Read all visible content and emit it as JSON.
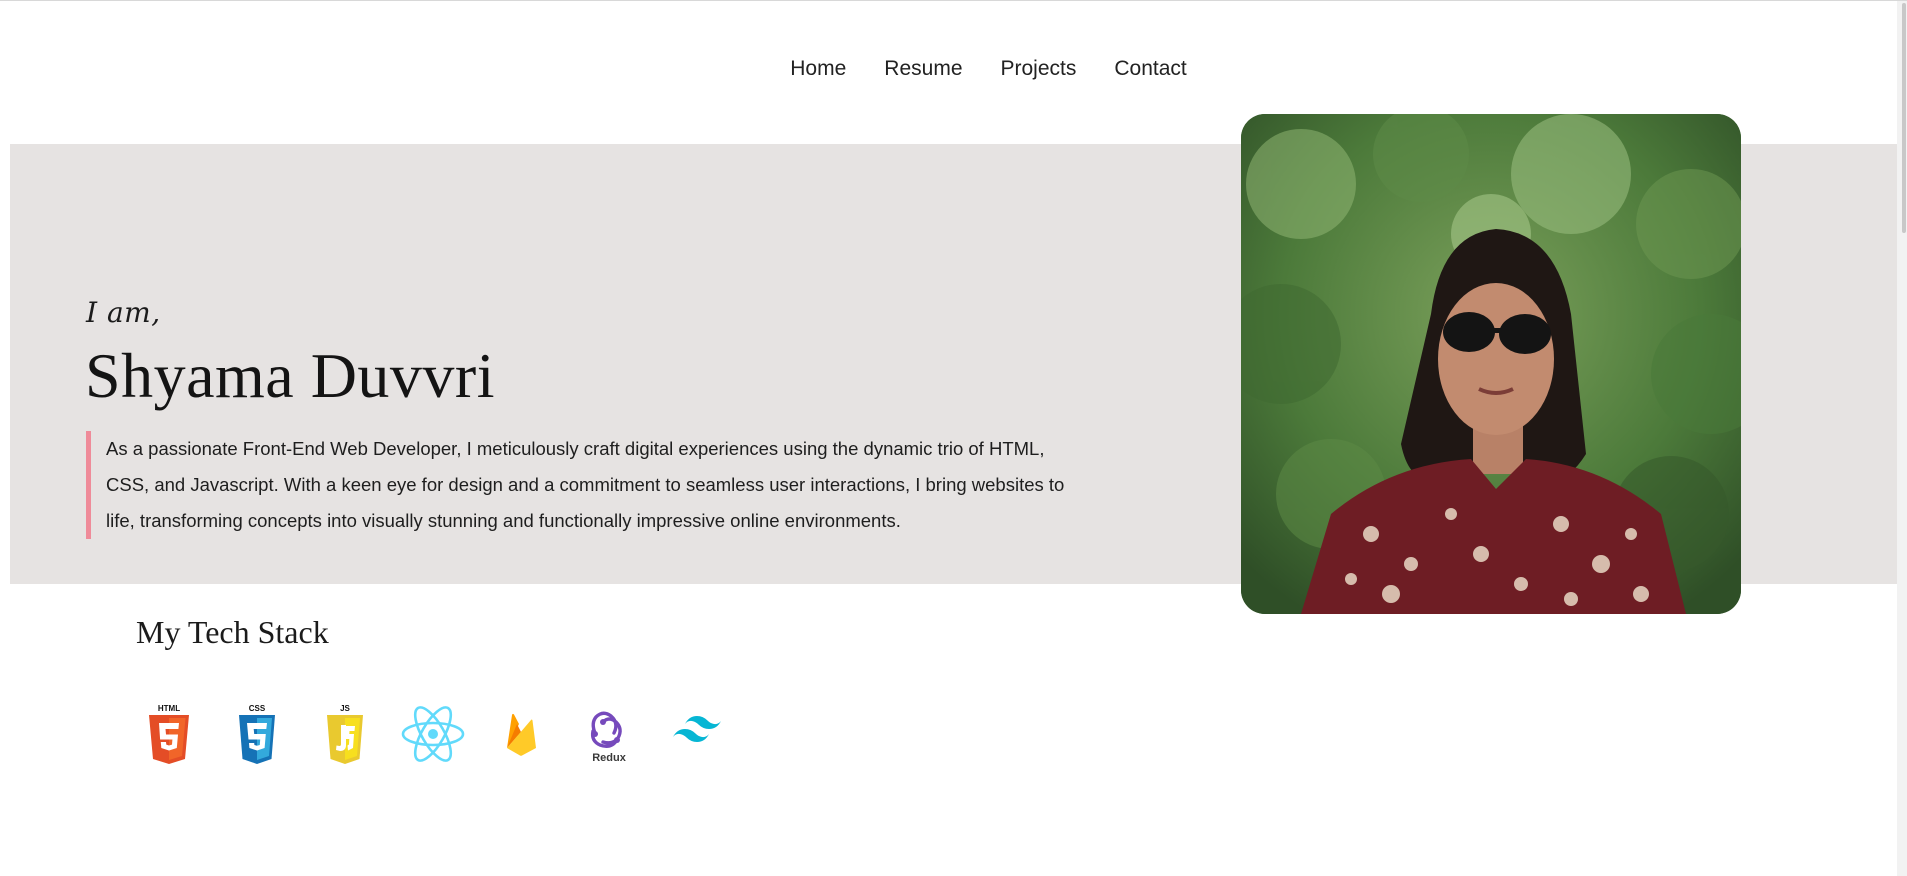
{
  "nav": {
    "items": [
      "Home",
      "Resume",
      "Projects",
      "Contact"
    ]
  },
  "hero": {
    "greeting": "I am,",
    "name": "Shyama Duvvri",
    "bio": "As a passionate Front-End Web Developer, I meticulously craft digital experiences using the dynamic trio of HTML, CSS, and Javascript. With a keen eye for design and a commitment to seamless user interactions, I bring websites to life, transforming concepts into visually stunning and functionally impressive online environments.",
    "accent_color": "#ef8b99",
    "band_color": "#e6e3e2"
  },
  "profile_photo": {
    "alt": "profile-photo"
  },
  "tech_stack": {
    "title": "My Tech Stack",
    "icons": [
      {
        "name": "html5-icon",
        "label": "HTML",
        "color": "#e44d26"
      },
      {
        "name": "css3-icon",
        "label": "CSS",
        "color": "#1572b6"
      },
      {
        "name": "javascript-icon",
        "label": "JS",
        "color": "#f0db4f"
      },
      {
        "name": "react-icon",
        "color": "#61dafb"
      },
      {
        "name": "firebase-icon",
        "color": "#ffca28"
      },
      {
        "name": "redux-icon",
        "label": "Redux",
        "color": "#764abc"
      },
      {
        "name": "tailwind-icon",
        "color": "#06b6d4"
      }
    ]
  }
}
